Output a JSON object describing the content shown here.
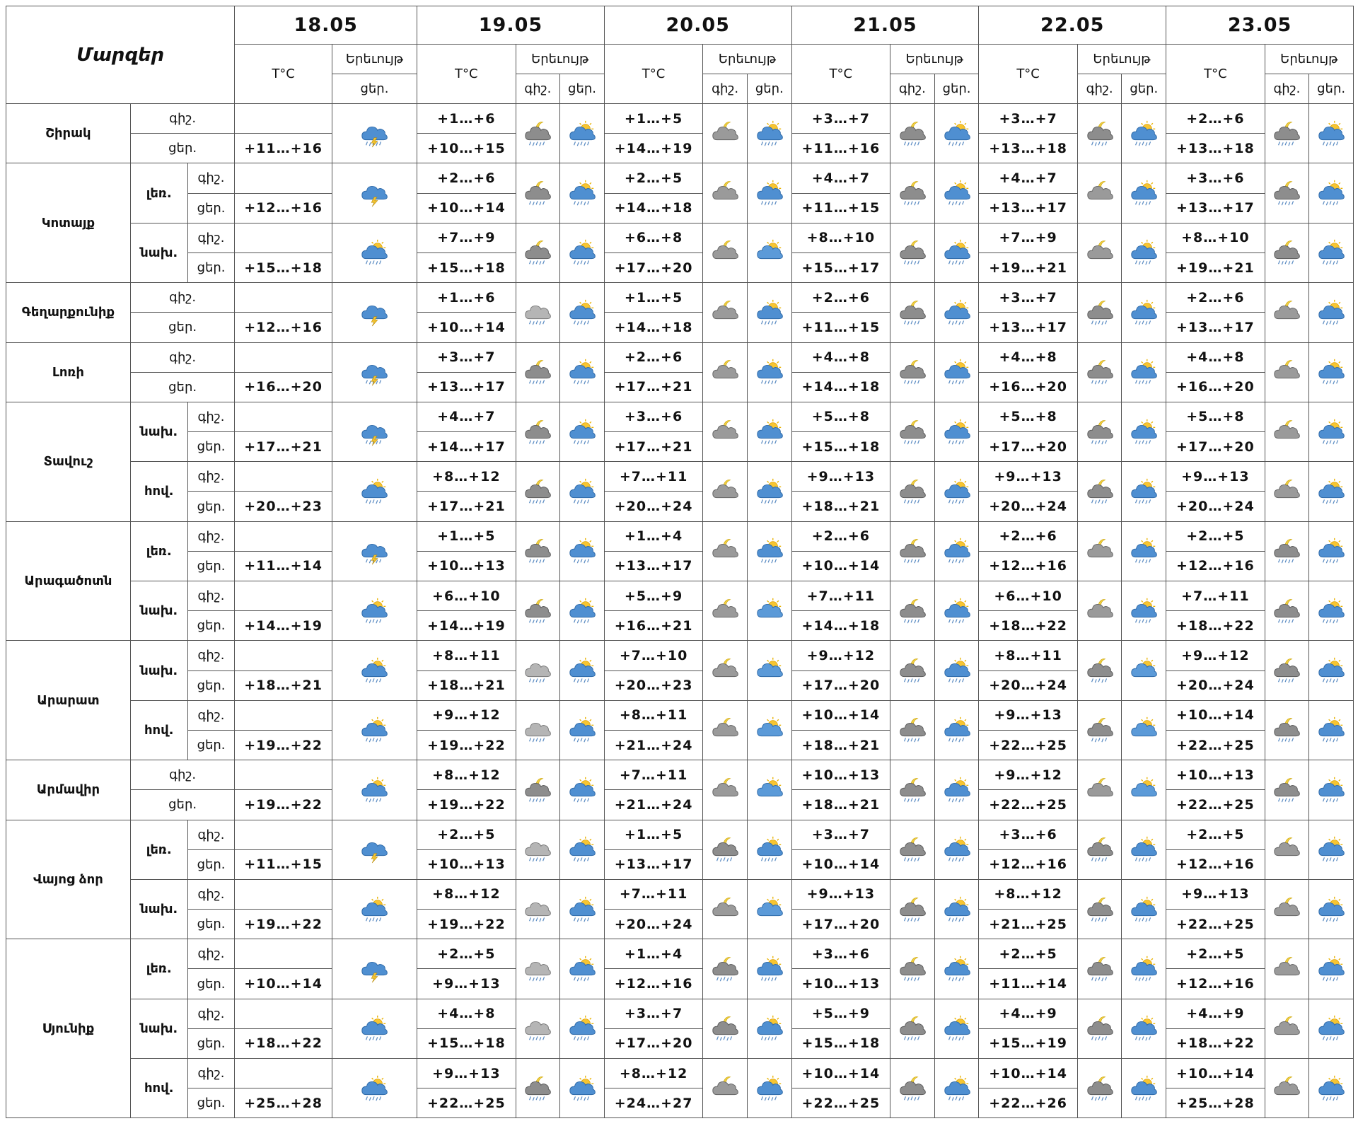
{
  "header": {
    "regions_label": "Մարզեր",
    "temp_label": "T°C",
    "phenomenon_label": "Երեւույթ",
    "night_label": "գիշ.",
    "day_label": "ցեր.",
    "dates": [
      "18.05",
      "19.05",
      "20.05",
      "21.05",
      "22.05",
      "23.05"
    ]
  },
  "regions": [
    {
      "name": "Շիրակ",
      "subs": [
        {
          "label": "",
          "d18": {
            "day": "+11…+16",
            "icon": "cloud-rain-lightning-icon"
          },
          "days": [
            {
              "night": "+1…+6",
              "day": "+10…+15",
              "ni": "moon-cloud-rain-icon",
              "di": "sun-cloud-rain-icon"
            },
            {
              "night": "+1…+5",
              "day": "+14…+19",
              "ni": "moon-cloud-icon",
              "di": "sun-cloud-rain-icon"
            },
            {
              "night": "+3…+7",
              "day": "+11…+16",
              "ni": "moon-cloud-rain-icon",
              "di": "sun-cloud-rain-icon"
            },
            {
              "night": "+3…+7",
              "day": "+13…+18",
              "ni": "moon-cloud-rain-icon",
              "di": "sun-cloud-rain-icon"
            },
            {
              "night": "+2…+6",
              "day": "+13…+18",
              "ni": "moon-cloud-rain-icon",
              "di": "sun-cloud-rain-icon"
            }
          ]
        }
      ]
    },
    {
      "name": "Կոտայք",
      "subs": [
        {
          "label": "լեռ.",
          "d18": {
            "day": "+12…+16",
            "icon": "cloud-lightning-icon"
          },
          "days": [
            {
              "night": "+2…+6",
              "day": "+10…+14",
              "ni": "moon-cloud-rain-icon",
              "di": "sun-cloud-rain-icon"
            },
            {
              "night": "+2…+5",
              "day": "+14…+18",
              "ni": "moon-cloud-icon",
              "di": "sun-cloud-rain-icon"
            },
            {
              "night": "+4…+7",
              "day": "+11…+15",
              "ni": "moon-cloud-rain-icon",
              "di": "sun-cloud-rain-icon"
            },
            {
              "night": "+4…+7",
              "day": "+13…+17",
              "ni": "moon-cloud-icon",
              "di": "sun-cloud-rain-icon"
            },
            {
              "night": "+3…+6",
              "day": "+13…+17",
              "ni": "moon-cloud-rain-icon",
              "di": "sun-cloud-rain-icon"
            }
          ]
        },
        {
          "label": "նախ.",
          "d18": {
            "day": "+15…+18",
            "icon": "sun-cloud-rain-icon"
          },
          "days": [
            {
              "night": "+7…+9",
              "day": "+15…+18",
              "ni": "moon-cloud-rain-icon",
              "di": "sun-cloud-rain-icon"
            },
            {
              "night": "+6…+8",
              "day": "+17…+20",
              "ni": "moon-cloud-icon",
              "di": "sun-cloud-icon"
            },
            {
              "night": "+8…+10",
              "day": "+15…+17",
              "ni": "moon-cloud-rain-icon",
              "di": "sun-cloud-rain-icon"
            },
            {
              "night": "+7…+9",
              "day": "+19…+21",
              "ni": "moon-cloud-icon",
              "di": "sun-cloud-rain-icon"
            },
            {
              "night": "+8…+10",
              "day": "+19…+21",
              "ni": "moon-cloud-rain-icon",
              "di": "sun-cloud-rain-icon"
            }
          ]
        }
      ]
    },
    {
      "name": "Գեղարքունիք",
      "subs": [
        {
          "label": "",
          "d18": {
            "day": "+12…+16",
            "icon": "cloud-lightning-icon"
          },
          "days": [
            {
              "night": "+1…+6",
              "day": "+10…+14",
              "ni": "cloud-rain-icon",
              "di": "sun-cloud-rain-icon"
            },
            {
              "night": "+1…+5",
              "day": "+14…+18",
              "ni": "moon-cloud-icon",
              "di": "sun-cloud-rain-icon"
            },
            {
              "night": "+2…+6",
              "day": "+11…+15",
              "ni": "moon-cloud-rain-icon",
              "di": "sun-cloud-rain-icon"
            },
            {
              "night": "+3…+7",
              "day": "+13…+17",
              "ni": "moon-cloud-rain-icon",
              "di": "sun-cloud-rain-icon"
            },
            {
              "night": "+2…+6",
              "day": "+13…+17",
              "ni": "moon-cloud-icon",
              "di": "sun-cloud-rain-icon"
            }
          ]
        }
      ]
    },
    {
      "name": "Լոռի",
      "subs": [
        {
          "label": "",
          "d18": {
            "day": "+16…+20",
            "icon": "cloud-rain-lightning-icon"
          },
          "days": [
            {
              "night": "+3…+7",
              "day": "+13…+17",
              "ni": "moon-cloud-rain-icon",
              "di": "sun-cloud-rain-icon"
            },
            {
              "night": "+2…+6",
              "day": "+17…+21",
              "ni": "moon-cloud-icon",
              "di": "sun-cloud-rain-icon"
            },
            {
              "night": "+4…+8",
              "day": "+14…+18",
              "ni": "moon-cloud-rain-icon",
              "di": "sun-cloud-rain-icon"
            },
            {
              "night": "+4…+8",
              "day": "+16…+20",
              "ni": "moon-cloud-rain-icon",
              "di": "sun-cloud-rain-icon"
            },
            {
              "night": "+4…+8",
              "day": "+16…+20",
              "ni": "moon-cloud-icon",
              "di": "sun-cloud-rain-icon"
            }
          ]
        }
      ]
    },
    {
      "name": "Տավուշ",
      "subs": [
        {
          "label": "նախ.",
          "d18": {
            "day": "+17…+21",
            "icon": "cloud-rain-lightning-icon"
          },
          "days": [
            {
              "night": "+4…+7",
              "day": "+14…+17",
              "ni": "moon-cloud-rain-icon",
              "di": "sun-cloud-rain-icon"
            },
            {
              "night": "+3…+6",
              "day": "+17…+21",
              "ni": "moon-cloud-icon",
              "di": "sun-cloud-rain-icon"
            },
            {
              "night": "+5…+8",
              "day": "+15…+18",
              "ni": "moon-cloud-rain-icon",
              "di": "sun-cloud-rain-icon"
            },
            {
              "night": "+5…+8",
              "day": "+17…+20",
              "ni": "moon-cloud-rain-icon",
              "di": "sun-cloud-rain-icon"
            },
            {
              "night": "+5…+8",
              "day": "+17…+20",
              "ni": "moon-cloud-icon",
              "di": "sun-cloud-rain-icon"
            }
          ]
        },
        {
          "label": "հով.",
          "d18": {
            "day": "+20…+23",
            "icon": "sun-cloud-rain-icon"
          },
          "days": [
            {
              "night": "+8…+12",
              "day": "+17…+21",
              "ni": "moon-cloud-rain-icon",
              "di": "sun-cloud-rain-icon"
            },
            {
              "night": "+7…+11",
              "day": "+20…+24",
              "ni": "moon-cloud-icon",
              "di": "sun-cloud-rain-icon"
            },
            {
              "night": "+9…+13",
              "day": "+18…+21",
              "ni": "moon-cloud-rain-icon",
              "di": "sun-cloud-rain-icon"
            },
            {
              "night": "+9…+13",
              "day": "+20…+24",
              "ni": "moon-cloud-rain-icon",
              "di": "sun-cloud-rain-icon"
            },
            {
              "night": "+9…+13",
              "day": "+20…+24",
              "ni": "moon-cloud-icon",
              "di": "sun-cloud-rain-icon"
            }
          ]
        }
      ]
    },
    {
      "name": "Արագածոտն",
      "subs": [
        {
          "label": "լեռ.",
          "d18": {
            "day": "+11…+14",
            "icon": "cloud-rain-lightning-icon"
          },
          "days": [
            {
              "night": "+1…+5",
              "day": "+10…+13",
              "ni": "moon-cloud-rain-icon",
              "di": "sun-cloud-rain-icon"
            },
            {
              "night": "+1…+4",
              "day": "+13…+17",
              "ni": "moon-cloud-icon",
              "di": "sun-cloud-rain-icon"
            },
            {
              "night": "+2…+6",
              "day": "+10…+14",
              "ni": "moon-cloud-rain-icon",
              "di": "sun-cloud-rain-icon"
            },
            {
              "night": "+2…+6",
              "day": "+12…+16",
              "ni": "moon-cloud-icon",
              "di": "sun-cloud-rain-icon"
            },
            {
              "night": "+2…+5",
              "day": "+12…+16",
              "ni": "moon-cloud-rain-icon",
              "di": "sun-cloud-rain-icon"
            }
          ]
        },
        {
          "label": "նախ.",
          "d18": {
            "day": "+14…+19",
            "icon": "sun-cloud-rain-icon"
          },
          "days": [
            {
              "night": "+6…+10",
              "day": "+14…+19",
              "ni": "moon-cloud-rain-icon",
              "di": "sun-cloud-rain-icon"
            },
            {
              "night": "+5…+9",
              "day": "+16…+21",
              "ni": "moon-cloud-icon",
              "di": "sun-cloud-icon"
            },
            {
              "night": "+7…+11",
              "day": "+14…+18",
              "ni": "moon-cloud-rain-icon",
              "di": "sun-cloud-rain-icon"
            },
            {
              "night": "+6…+10",
              "day": "+18…+22",
              "ni": "moon-cloud-icon",
              "di": "sun-cloud-rain-icon"
            },
            {
              "night": "+7…+11",
              "day": "+18…+22",
              "ni": "moon-cloud-rain-icon",
              "di": "sun-cloud-rain-icon"
            }
          ]
        }
      ]
    },
    {
      "name": "Արարատ",
      "subs": [
        {
          "label": "նախ.",
          "d18": {
            "day": "+18…+21",
            "icon": "sun-cloud-rain-icon"
          },
          "days": [
            {
              "night": "+8…+11",
              "day": "+18…+21",
              "ni": "cloud-rain-icon",
              "di": "sun-cloud-rain-icon"
            },
            {
              "night": "+7…+10",
              "day": "+20…+23",
              "ni": "moon-cloud-icon",
              "di": "sun-cloud-icon"
            },
            {
              "night": "+9…+12",
              "day": "+17…+20",
              "ni": "moon-cloud-rain-icon",
              "di": "sun-cloud-rain-icon"
            },
            {
              "night": "+8…+11",
              "day": "+20…+24",
              "ni": "moon-cloud-rain-icon",
              "di": "sun-cloud-icon"
            },
            {
              "night": "+9…+12",
              "day": "+20…+24",
              "ni": "moon-cloud-rain-icon",
              "di": "sun-cloud-rain-icon"
            }
          ]
        },
        {
          "label": "հով.",
          "d18": {
            "day": "+19…+22",
            "icon": "sun-cloud-rain-icon"
          },
          "days": [
            {
              "night": "+9…+12",
              "day": "+19…+22",
              "ni": "cloud-rain-icon",
              "di": "sun-cloud-rain-icon"
            },
            {
              "night": "+8…+11",
              "day": "+21…+24",
              "ni": "moon-cloud-icon",
              "di": "sun-cloud-icon"
            },
            {
              "night": "+10…+14",
              "day": "+18…+21",
              "ni": "moon-cloud-rain-icon",
              "di": "sun-cloud-rain-icon"
            },
            {
              "night": "+9…+13",
              "day": "+22…+25",
              "ni": "moon-cloud-rain-icon",
              "di": "sun-cloud-icon"
            },
            {
              "night": "+10…+14",
              "day": "+22…+25",
              "ni": "moon-cloud-rain-icon",
              "di": "sun-cloud-rain-icon"
            }
          ]
        }
      ]
    },
    {
      "name": "Արմավիր",
      "subs": [
        {
          "label": "",
          "d18": {
            "day": "+19…+22",
            "icon": "sun-cloud-rain-icon"
          },
          "days": [
            {
              "night": "+8…+12",
              "day": "+19…+22",
              "ni": "moon-cloud-rain-icon",
              "di": "sun-cloud-rain-icon"
            },
            {
              "night": "+7…+11",
              "day": "+21…+24",
              "ni": "moon-cloud-icon",
              "di": "sun-cloud-icon"
            },
            {
              "night": "+10…+13",
              "day": "+18…+21",
              "ni": "moon-cloud-rain-icon",
              "di": "sun-cloud-rain-icon"
            },
            {
              "night": "+9…+12",
              "day": "+22…+25",
              "ni": "moon-cloud-icon",
              "di": "sun-cloud-icon"
            },
            {
              "night": "+10…+13",
              "day": "+22…+25",
              "ni": "moon-cloud-rain-icon",
              "di": "sun-cloud-rain-icon"
            }
          ]
        }
      ]
    },
    {
      "name": "Վայոց ձոր",
      "subs": [
        {
          "label": "լեռ.",
          "d18": {
            "day": "+11…+15",
            "icon": "cloud-lightning-icon"
          },
          "days": [
            {
              "night": "+2…+5",
              "day": "+10…+13",
              "ni": "cloud-rain-icon",
              "di": "sun-cloud-rain-icon"
            },
            {
              "night": "+1…+5",
              "day": "+13…+17",
              "ni": "moon-cloud-rain-icon",
              "di": "sun-cloud-rain-icon"
            },
            {
              "night": "+3…+7",
              "day": "+10…+14",
              "ni": "moon-cloud-rain-icon",
              "di": "sun-cloud-rain-icon"
            },
            {
              "night": "+3…+6",
              "day": "+12…+16",
              "ni": "moon-cloud-rain-icon",
              "di": "sun-cloud-rain-icon"
            },
            {
              "night": "+2…+5",
              "day": "+12…+16",
              "ni": "moon-cloud-icon",
              "di": "sun-cloud-rain-icon"
            }
          ]
        },
        {
          "label": "նախ.",
          "d18": {
            "day": "+19…+22",
            "icon": "sun-cloud-rain-icon"
          },
          "days": [
            {
              "night": "+8…+12",
              "day": "+19…+22",
              "ni": "cloud-rain-icon",
              "di": "sun-cloud-rain-icon"
            },
            {
              "night": "+7…+11",
              "day": "+20…+24",
              "ni": "moon-cloud-icon",
              "di": "sun-cloud-icon"
            },
            {
              "night": "+9…+13",
              "day": "+17…+20",
              "ni": "moon-cloud-rain-icon",
              "di": "sun-cloud-rain-icon"
            },
            {
              "night": "+8…+12",
              "day": "+21…+25",
              "ni": "moon-cloud-rain-icon",
              "di": "sun-cloud-rain-icon"
            },
            {
              "night": "+9…+13",
              "day": "+22…+25",
              "ni": "moon-cloud-icon",
              "di": "sun-cloud-rain-icon"
            }
          ]
        }
      ]
    },
    {
      "name": "Սյունիք",
      "subs": [
        {
          "label": "լեռ.",
          "d18": {
            "day": "+10…+14",
            "icon": "cloud-lightning-icon"
          },
          "days": [
            {
              "night": "+2…+5",
              "day": "+9…+13",
              "ni": "cloud-rain-icon",
              "di": "sun-cloud-rain-icon"
            },
            {
              "night": "+1…+4",
              "day": "+12…+16",
              "ni": "moon-cloud-rain-icon",
              "di": "sun-cloud-rain-icon"
            },
            {
              "night": "+3…+6",
              "day": "+10…+13",
              "ni": "moon-cloud-rain-icon",
              "di": "sun-cloud-rain-icon"
            },
            {
              "night": "+2…+5",
              "day": "+11…+14",
              "ni": "moon-cloud-rain-icon",
              "di": "sun-cloud-rain-icon"
            },
            {
              "night": "+2…+5",
              "day": "+12…+16",
              "ni": "moon-cloud-icon",
              "di": "sun-cloud-rain-icon"
            }
          ]
        },
        {
          "label": "նախ.",
          "d18": {
            "day": "+18…+22",
            "icon": "sun-cloud-rain-icon"
          },
          "days": [
            {
              "night": "+4…+8",
              "day": "+15…+18",
              "ni": "cloud-rain-icon",
              "di": "sun-cloud-rain-icon"
            },
            {
              "night": "+3…+7",
              "day": "+17…+20",
              "ni": "moon-cloud-rain-icon",
              "di": "sun-cloud-rain-icon"
            },
            {
              "night": "+5…+9",
              "day": "+15…+18",
              "ni": "moon-cloud-rain-icon",
              "di": "sun-cloud-rain-icon"
            },
            {
              "night": "+4…+9",
              "day": "+15…+19",
              "ni": "moon-cloud-rain-icon",
              "di": "sun-cloud-rain-icon"
            },
            {
              "night": "+4…+9",
              "day": "+18…+22",
              "ni": "moon-cloud-icon",
              "di": "sun-cloud-rain-icon"
            }
          ]
        },
        {
          "label": "հով.",
          "d18": {
            "day": "+25…+28",
            "icon": "sun-cloud-rain-icon"
          },
          "days": [
            {
              "night": "+9…+13",
              "day": "+22…+25",
              "ni": "moon-cloud-rain-icon",
              "di": "sun-cloud-rain-icon"
            },
            {
              "night": "+8…+12",
              "day": "+24…+27",
              "ni": "moon-cloud-icon",
              "di": "sun-cloud-rain-icon"
            },
            {
              "night": "+10…+14",
              "day": "+22…+25",
              "ni": "moon-cloud-rain-icon",
              "di": "sun-cloud-rain-icon"
            },
            {
              "night": "+10…+14",
              "day": "+22…+26",
              "ni": "moon-cloud-rain-icon",
              "di": "sun-cloud-rain-icon"
            },
            {
              "night": "+10…+14",
              "day": "+25…+28",
              "ni": "moon-cloud-icon",
              "di": "sun-cloud-rain-icon"
            }
          ]
        }
      ]
    }
  ]
}
